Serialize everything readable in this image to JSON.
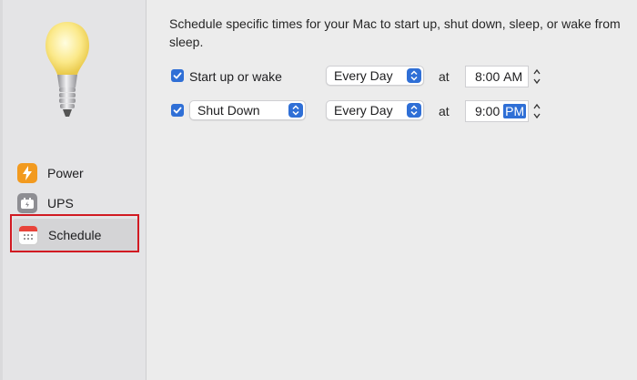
{
  "sidebar": {
    "items": [
      {
        "label": "Power",
        "icon": "lightning-icon"
      },
      {
        "label": "UPS",
        "icon": "battery-plug-icon"
      },
      {
        "label": "Schedule",
        "icon": "calendar-icon",
        "selected": true
      }
    ]
  },
  "main": {
    "description": "Schedule specific times for your Mac to start up, shut down, sleep, or wake from sleep.",
    "rows": [
      {
        "checked": true,
        "action": "Start up or wake",
        "frequency": "Every Day",
        "at_label": "at",
        "time_value": "8:00",
        "time_period": "AM"
      },
      {
        "checked": true,
        "action": "Shut Down",
        "frequency": "Every Day",
        "at_label": "at",
        "time_value": "9:00",
        "time_period": "PM"
      }
    ]
  },
  "colors": {
    "accent": "#2f6fd6",
    "highlight": "#d11a22"
  }
}
